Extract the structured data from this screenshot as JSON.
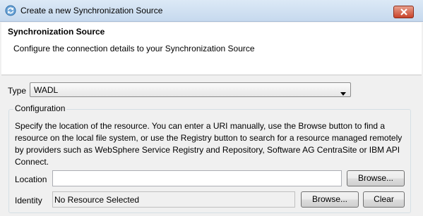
{
  "window": {
    "title": "Create a new Synchronization Source",
    "icons": {
      "app": "sync-icon",
      "close": "close-icon"
    },
    "colors": {
      "close_button": "#c8432a",
      "titlebar": "#dce9f6"
    }
  },
  "header": {
    "title": "Synchronization Source",
    "description": "Configure the connection details to your Synchronization Source"
  },
  "type": {
    "label": "Type",
    "value": "WADL"
  },
  "configuration": {
    "legend": "Configuration",
    "description": "Specify the location of the resource.  You can enter a URI manually, use the Browse button to find a resource on the local file system, or use the Registry button to search for a resource managed remotely by providers such as WebSphere Service Registry and Repository, Software AG CentraSite or IBM API Connect.",
    "location": {
      "label": "Location",
      "value": "",
      "browse_label": "Browse..."
    },
    "identity": {
      "label": "Identity",
      "value": "No Resource Selected",
      "browse_label": "Browse...",
      "clear_label": "Clear"
    }
  }
}
